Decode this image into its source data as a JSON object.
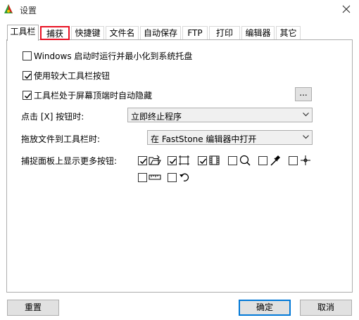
{
  "window": {
    "title": "设置",
    "close_icon": "close-icon"
  },
  "tabs": [
    {
      "label": "工具栏",
      "active": true
    },
    {
      "label": "捕获",
      "highlighted": true
    },
    {
      "label": "快捷键"
    },
    {
      "label": "文件名"
    },
    {
      "label": "自动保存"
    },
    {
      "label": "FTP"
    },
    {
      "label": "打印"
    },
    {
      "label": "编辑器"
    },
    {
      "label": "其它"
    }
  ],
  "options": {
    "start_minimized": {
      "label": "Windows 启动时运行并最小化到系统托盘",
      "checked": false
    },
    "larger_buttons": {
      "label": "使用较大工具栏按钮",
      "checked": true
    },
    "autohide": {
      "label": "工具栏处于屏幕顶端时自动隐藏",
      "checked": true,
      "more_label": "..."
    }
  },
  "close_action": {
    "label": "点击 [X] 按钮时:",
    "value": "立即终止程序"
  },
  "drop_action": {
    "label": "拖放文件到工具栏时:",
    "value": "在 FastStone 编辑器中打开"
  },
  "capture_panel": {
    "label": "捕捉面板上显示更多按钮:",
    "buttons": [
      {
        "icon": "open-folder-icon",
        "checked": true
      },
      {
        "icon": "crop-frame-icon",
        "checked": true
      },
      {
        "icon": "film-strip-icon",
        "checked": true
      },
      {
        "icon": "magnifier-icon",
        "checked": false
      },
      {
        "icon": "color-picker-icon",
        "checked": false
      },
      {
        "icon": "crosshair-icon",
        "checked": false
      },
      {
        "icon": "ruler-icon",
        "checked": false
      },
      {
        "icon": "undo-arrow-icon",
        "checked": false
      }
    ]
  },
  "footer": {
    "reset_label": "重置",
    "ok_label": "确定",
    "cancel_label": "取消"
  },
  "colors": {
    "highlight": "#e81123",
    "accent": "#0078d7"
  }
}
